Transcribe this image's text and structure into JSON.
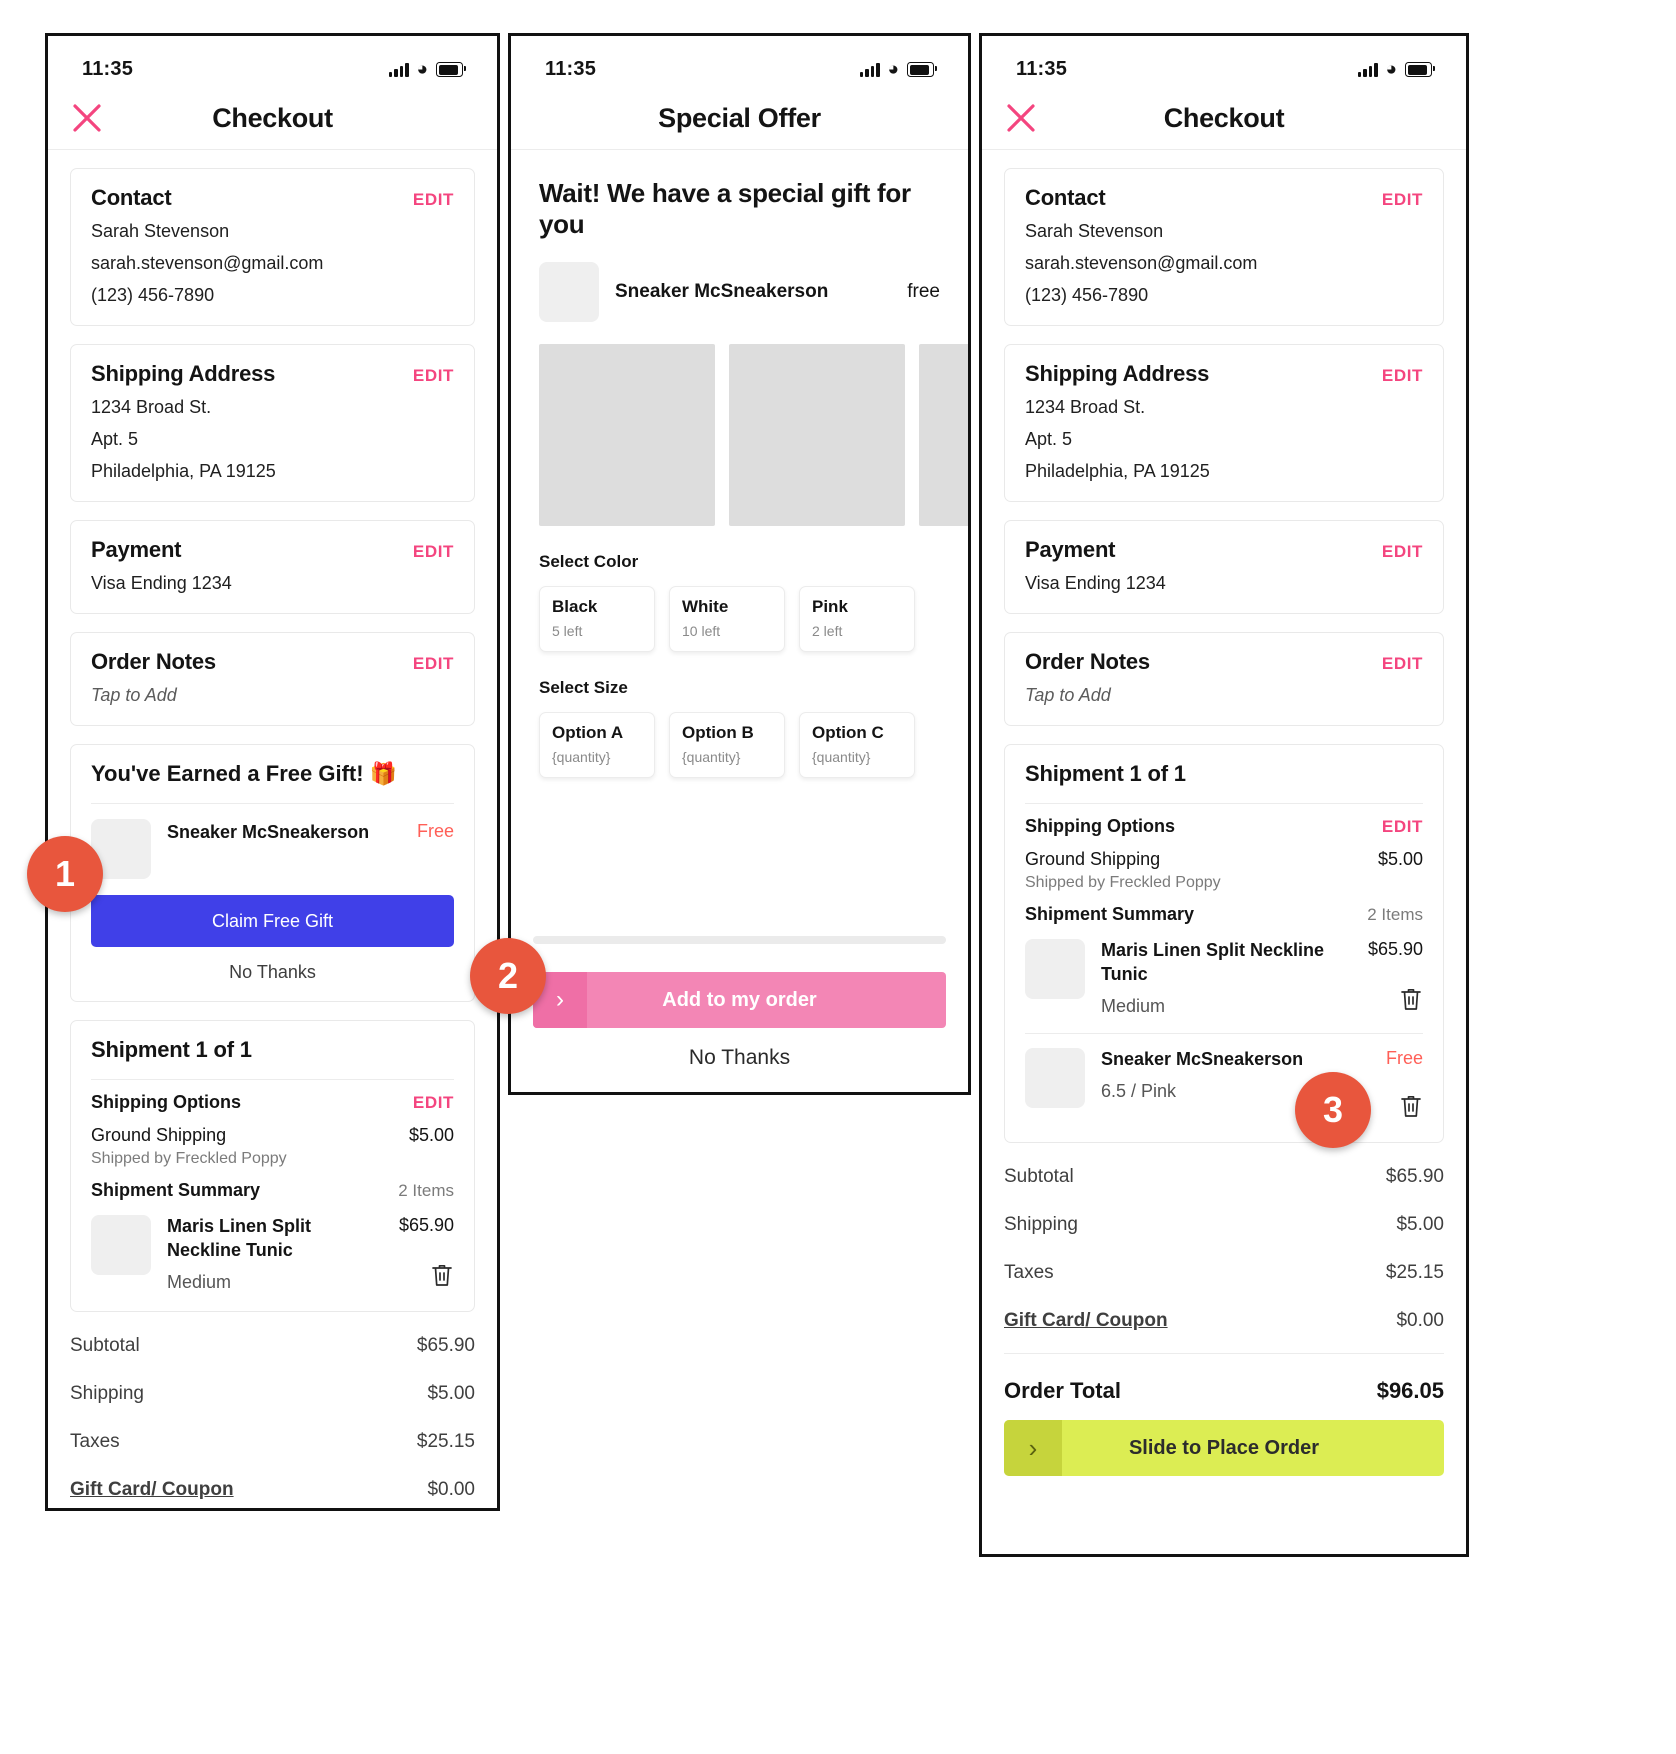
{
  "status_bar": {
    "time": "11:35"
  },
  "panel1": {
    "nav": {
      "title": "Checkout",
      "close_icon": "close-icon"
    },
    "contact": {
      "title": "Contact",
      "edit": "EDIT",
      "name": "Sarah Stevenson",
      "email": "sarah.stevenson@gmail.com",
      "phone": "(123) 456-7890"
    },
    "shipping_address": {
      "title": "Shipping Address",
      "edit": "EDIT",
      "line1": "1234 Broad St.",
      "line2": "Apt. 5",
      "line3": "Philadelphia, PA 19125"
    },
    "payment": {
      "title": "Payment",
      "edit": "EDIT",
      "value": "Visa Ending 1234"
    },
    "order_notes": {
      "title": "Order Notes",
      "edit": "EDIT",
      "value": "Tap to Add"
    },
    "free_gift": {
      "title": "You've Earned a Free Gift! 🎁",
      "product_name": "Sneaker McSneakerson",
      "product_price": "Free",
      "claim_label": "Claim Free Gift",
      "decline_label": "No Thanks"
    },
    "shipment": {
      "title": "Shipment 1 of 1",
      "shipping_options_label": "Shipping Options",
      "shipping_options_edit": "EDIT",
      "method": "Ground Shipping",
      "method_price": "$5.00",
      "shipped_by": "Shipped by Freckled Poppy",
      "summary_label": "Shipment Summary",
      "summary_count": "2 Items",
      "items": [
        {
          "name": "Maris Linen Split Neckline Tunic",
          "option": "Medium",
          "price": "$65.90",
          "delete_icon": "trash-icon"
        }
      ]
    },
    "totals": [
      {
        "label": "Subtotal",
        "value": "$65.90",
        "link": false
      },
      {
        "label": "Shipping",
        "value": "$5.00",
        "link": false
      },
      {
        "label": "Taxes",
        "value": "$25.15",
        "link": false
      },
      {
        "label": "Gift Card/ Coupon",
        "value": "$0.00",
        "link": true
      }
    ]
  },
  "panel2": {
    "nav": {
      "title": "Special Offer"
    },
    "heading": "Wait! We have a special gift for you",
    "product": {
      "name": "Sneaker McSneakerson",
      "price": "free"
    },
    "gallery_count": 3,
    "select_color_label": "Select Color",
    "colors": [
      {
        "name": "Black",
        "stock": "5 left"
      },
      {
        "name": "White",
        "stock": "10 left"
      },
      {
        "name": "Pink",
        "stock": "2 left"
      }
    ],
    "select_size_label": "Select Size",
    "sizes": [
      {
        "name": "Option A",
        "stock": "{quantity}"
      },
      {
        "name": "Option B",
        "stock": "{quantity}"
      },
      {
        "name": "Option C",
        "stock": "{quantity}"
      }
    ],
    "add_button": {
      "label": "Add to my order",
      "handle_icon": "chevron-right-icon"
    },
    "decline_label": "No Thanks"
  },
  "panel3": {
    "nav": {
      "title": "Checkout",
      "close_icon": "close-icon"
    },
    "contact": {
      "title": "Contact",
      "edit": "EDIT",
      "name": "Sarah Stevenson",
      "email": "sarah.stevenson@gmail.com",
      "phone": "(123) 456-7890"
    },
    "shipping_address": {
      "title": "Shipping Address",
      "edit": "EDIT",
      "line1": "1234 Broad St.",
      "line2": "Apt. 5",
      "line3": "Philadelphia, PA 19125"
    },
    "payment": {
      "title": "Payment",
      "edit": "EDIT",
      "value": "Visa Ending 1234"
    },
    "order_notes": {
      "title": "Order Notes",
      "edit": "EDIT",
      "value": "Tap to Add"
    },
    "shipment": {
      "title": "Shipment 1 of 1",
      "shipping_options_label": "Shipping Options",
      "shipping_options_edit": "EDIT",
      "method": "Ground Shipping",
      "method_price": "$5.00",
      "shipped_by": "Shipped by Freckled Poppy",
      "summary_label": "Shipment Summary",
      "summary_count": "2 Items",
      "items": [
        {
          "name": "Maris Linen Split Neckline Tunic",
          "option": "Medium",
          "price": "$65.90",
          "delete_icon": "trash-icon"
        },
        {
          "name": "Sneaker McSneakerson",
          "option": "6.5 / Pink",
          "price": "Free",
          "delete_icon": "trash-icon"
        }
      ]
    },
    "totals": [
      {
        "label": "Subtotal",
        "value": "$65.90",
        "link": false
      },
      {
        "label": "Shipping",
        "value": "$5.00",
        "link": false
      },
      {
        "label": "Taxes",
        "value": "$25.15",
        "link": false
      },
      {
        "label": "Gift Card/ Coupon",
        "value": "$0.00",
        "link": true
      }
    ],
    "order_total": {
      "label": "Order Total",
      "value": "$96.05"
    },
    "place_order": {
      "label": "Slide to Place Order",
      "handle_icon": "chevron-right-icon"
    }
  },
  "step_badges": [
    {
      "number": "1"
    },
    {
      "number": "2"
    },
    {
      "number": "3"
    }
  ],
  "colors": {
    "accent_pink": "#f4457f",
    "primary_blue": "#4040e8",
    "offer_pink": "#f386b5",
    "place_order_green": "#dced53",
    "badge_orange": "#e8563d",
    "free_red": "#ff5f57"
  }
}
